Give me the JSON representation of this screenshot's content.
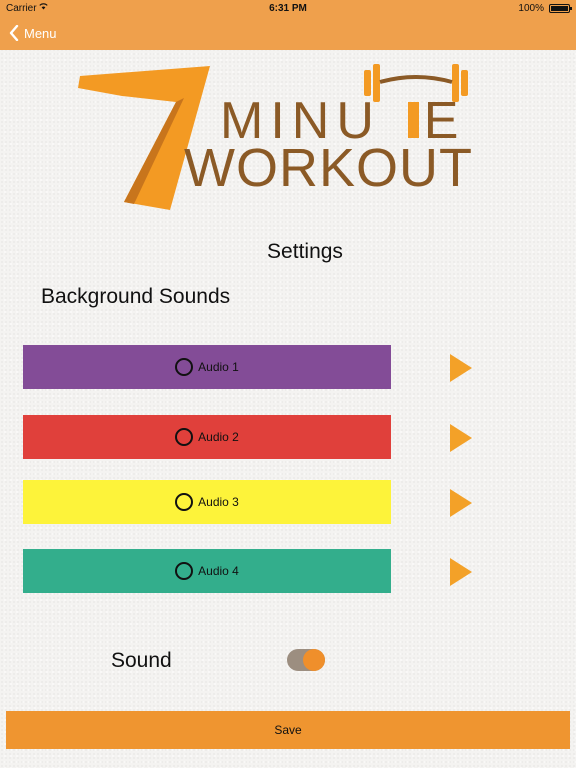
{
  "status_bar": {
    "carrier": "Carrier",
    "time": "6:31 PM",
    "battery": "100%"
  },
  "nav": {
    "back_label": "Menu"
  },
  "logo": {
    "number": "7",
    "line1": "MINU  E",
    "line2": "WORKOUT"
  },
  "page": {
    "title": "Settings",
    "section_title": "Background Sounds"
  },
  "audio_options": [
    {
      "label": "Audio 1",
      "color": "#834c97"
    },
    {
      "label": "Audio 2",
      "color": "#e0403b"
    },
    {
      "label": "Audio 3",
      "color": "#fdf33a"
    },
    {
      "label": "Audio 4",
      "color": "#33ae8c"
    }
  ],
  "sound": {
    "label": "Sound",
    "enabled": true
  },
  "save_label": "Save",
  "colors": {
    "accent": "#efa04c",
    "play": "#f3a128",
    "logo_orange": "#f39a23",
    "logo_brown": "#8b5a26"
  }
}
